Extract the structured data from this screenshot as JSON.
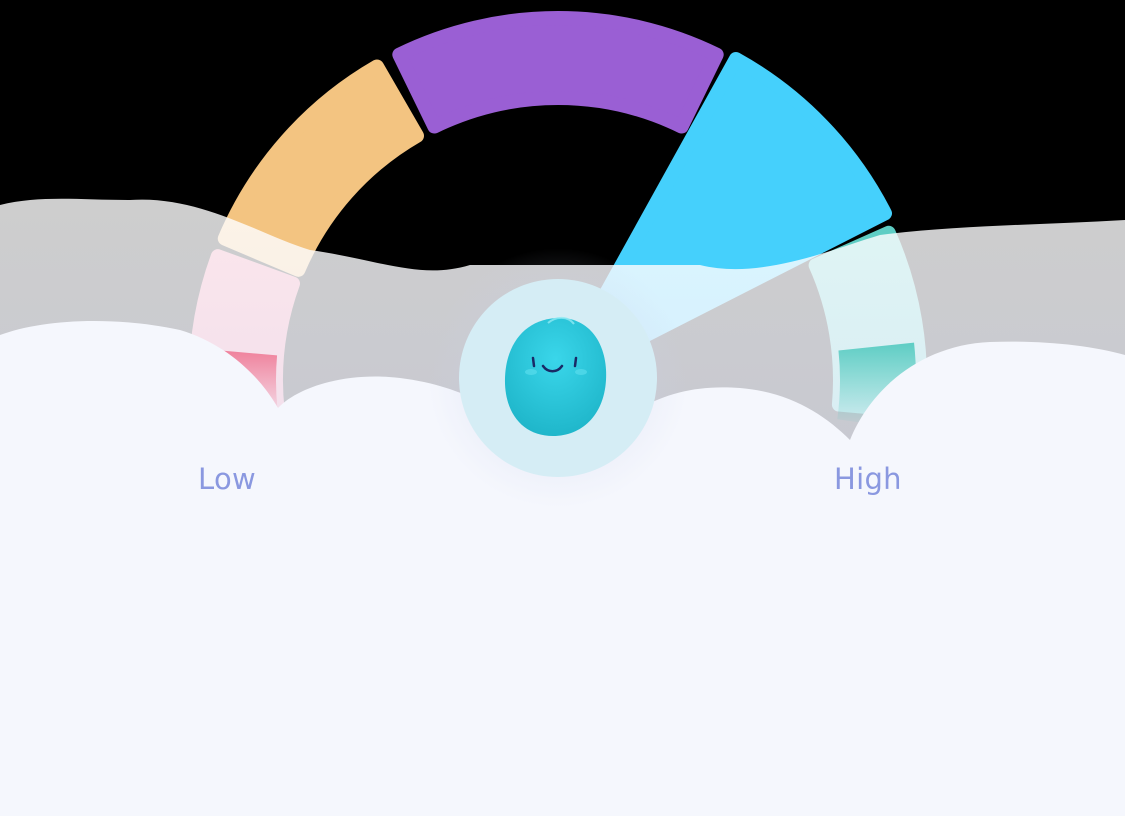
{
  "gauge": {
    "low_label": "Low",
    "high_label": "High",
    "segments": [
      {
        "name": "very-low",
        "color": "#ef7f9a"
      },
      {
        "name": "low",
        "color": "#f3c481"
      },
      {
        "name": "medium",
        "color": "#9a5fd4"
      },
      {
        "name": "high",
        "color": "#45d0fc"
      },
      {
        "name": "very-high",
        "color": "#5ecdc4"
      }
    ],
    "selected_segment": "high",
    "mascot": {
      "icon": "smiling-blob-icon",
      "color": "#27c3d9"
    }
  },
  "colors": {
    "background": "#000000",
    "cloud": "#f5f7fd",
    "label": "#8a98e0",
    "mascot_ring": "#d5edf5"
  }
}
